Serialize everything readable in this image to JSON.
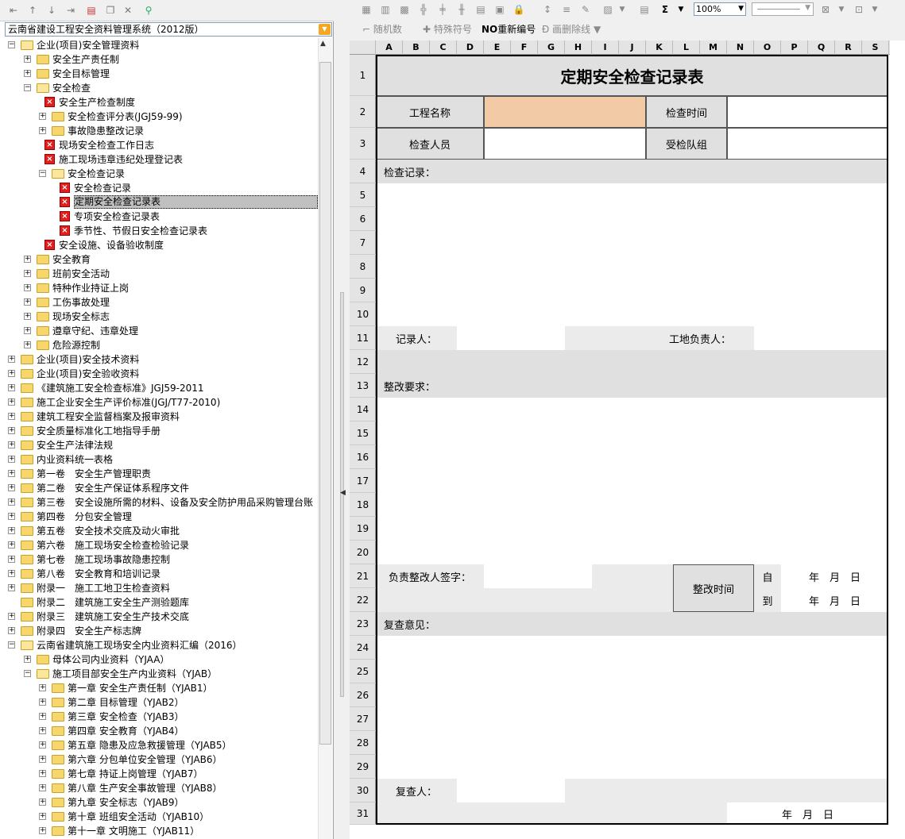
{
  "left_toolbar": {
    "icons": [
      "first-icon",
      "prev-icon",
      "next-icon",
      "last-icon",
      "add-record-icon",
      "copy-icon",
      "delete-icon",
      "filter-icon"
    ]
  },
  "selector": {
    "value": "云南省建设工程安全资料管理系统（2012版）"
  },
  "tree": [
    {
      "label": "企业(项目)安全管理资料",
      "level": 0,
      "type": "folder",
      "state": "open"
    },
    {
      "label": "安全生产责任制",
      "level": 1,
      "type": "folder",
      "state": "closed"
    },
    {
      "label": "安全目标管理",
      "level": 1,
      "type": "folder",
      "state": "closed"
    },
    {
      "label": "安全检查",
      "level": 1,
      "type": "folder",
      "state": "open"
    },
    {
      "label": "安全生产检查制度",
      "level": 2,
      "type": "doc"
    },
    {
      "label": "安全检查评分表(JGJ59-99)",
      "level": 2,
      "type": "folder",
      "state": "closed"
    },
    {
      "label": "事故隐患整改记录",
      "level": 2,
      "type": "folder",
      "state": "closed"
    },
    {
      "label": "现场安全检查工作日志",
      "level": 2,
      "type": "doc"
    },
    {
      "label": "施工现场违章违纪处理登记表",
      "level": 2,
      "type": "doc"
    },
    {
      "label": "安全检查记录",
      "level": 2,
      "type": "folder",
      "state": "open"
    },
    {
      "label": "安全检查记录",
      "level": 3,
      "type": "doc"
    },
    {
      "label": "定期安全检查记录表",
      "level": 3,
      "type": "doc",
      "selected": true
    },
    {
      "label": "专项安全检查记录表",
      "level": 3,
      "type": "doc"
    },
    {
      "label": "季节性、节假日安全检查记录表",
      "level": 3,
      "type": "doc"
    },
    {
      "label": "安全设施、设备验收制度",
      "level": 2,
      "type": "doc"
    },
    {
      "label": "安全教育",
      "level": 1,
      "type": "folder",
      "state": "closed"
    },
    {
      "label": "班前安全活动",
      "level": 1,
      "type": "folder",
      "state": "closed"
    },
    {
      "label": "特种作业持证上岗",
      "level": 1,
      "type": "folder",
      "state": "closed"
    },
    {
      "label": "工伤事故处理",
      "level": 1,
      "type": "folder",
      "state": "closed"
    },
    {
      "label": "现场安全标志",
      "level": 1,
      "type": "folder",
      "state": "closed"
    },
    {
      "label": "遵章守纪、违章处理",
      "level": 1,
      "type": "folder",
      "state": "closed"
    },
    {
      "label": "危险源控制",
      "level": 1,
      "type": "folder",
      "state": "closed"
    },
    {
      "label": "企业(项目)安全技术资料",
      "level": 0,
      "type": "folder",
      "state": "closed"
    },
    {
      "label": "企业(项目)安全验收资料",
      "level": 0,
      "type": "folder",
      "state": "closed"
    },
    {
      "label": "《建筑施工安全检查标准》JGJ59-2011",
      "level": 0,
      "type": "folder",
      "state": "closed"
    },
    {
      "label": "施工企业安全生产评价标准(JGJ/T77-2010)",
      "level": 0,
      "type": "folder",
      "state": "closed"
    },
    {
      "label": "建筑工程安全监督档案及报审资料",
      "level": 0,
      "type": "folder",
      "state": "closed"
    },
    {
      "label": "安全质量标准化工地指导手册",
      "level": 0,
      "type": "folder",
      "state": "closed"
    },
    {
      "label": "安全生产法律法规",
      "level": 0,
      "type": "folder",
      "state": "closed"
    },
    {
      "label": "内业资料统一表格",
      "level": 0,
      "type": "folder",
      "state": "closed"
    },
    {
      "label": "第一卷　安全生产管理职责",
      "level": 0,
      "type": "folder",
      "state": "closed"
    },
    {
      "label": "第二卷　安全生产保证体系程序文件",
      "level": 0,
      "type": "folder",
      "state": "closed"
    },
    {
      "label": "第三卷　安全设施所需的材料、设备及安全防护用品采购管理台账",
      "level": 0,
      "type": "folder",
      "state": "closed"
    },
    {
      "label": "第四卷　分包安全管理",
      "level": 0,
      "type": "folder",
      "state": "closed"
    },
    {
      "label": "第五卷　安全技术交底及动火审批",
      "level": 0,
      "type": "folder",
      "state": "closed"
    },
    {
      "label": "第六卷　施工现场安全检查检验记录",
      "level": 0,
      "type": "folder",
      "state": "closed"
    },
    {
      "label": "第七卷　施工现场事故隐患控制",
      "level": 0,
      "type": "folder",
      "state": "closed"
    },
    {
      "label": "第八卷　安全教育和培训记录",
      "level": 0,
      "type": "folder",
      "state": "closed"
    },
    {
      "label": "附录一　施工工地卫生检查资料",
      "level": 0,
      "type": "folder",
      "state": "closed"
    },
    {
      "label": "附录二　建筑施工安全生产测验题库",
      "level": 0,
      "type": "folder",
      "state": "none"
    },
    {
      "label": "附录三　建筑施工安全生产技术交底",
      "level": 0,
      "type": "folder",
      "state": "closed"
    },
    {
      "label": "附录四　安全生产标志牌",
      "level": 0,
      "type": "folder",
      "state": "closed"
    },
    {
      "label": "云南省建筑施工现场安全内业资料汇编（2016）",
      "level": 0,
      "type": "folder",
      "state": "open"
    },
    {
      "label": "母体公司内业资料（YJAA）",
      "level": 1,
      "type": "folder",
      "state": "closed"
    },
    {
      "label": "施工项目部安全生产内业资料（YJAB）",
      "level": 1,
      "type": "folder",
      "state": "open"
    },
    {
      "label": "第一章 安全生产责任制（YJAB1）",
      "level": 2,
      "type": "folder",
      "state": "closed"
    },
    {
      "label": "第二章 目标管理（YJAB2）",
      "level": 2,
      "type": "folder",
      "state": "closed"
    },
    {
      "label": "第三章 安全检查（YJAB3）",
      "level": 2,
      "type": "folder",
      "state": "closed"
    },
    {
      "label": "第四章 安全教育（YJAB4）",
      "level": 2,
      "type": "folder",
      "state": "closed"
    },
    {
      "label": "第五章 隐患及应急救援管理（YJAB5）",
      "level": 2,
      "type": "folder",
      "state": "closed"
    },
    {
      "label": "第六章 分包单位安全管理（YJAB6）",
      "level": 2,
      "type": "folder",
      "state": "closed"
    },
    {
      "label": "第七章 持证上岗管理（YJAB7）",
      "level": 2,
      "type": "folder",
      "state": "closed"
    },
    {
      "label": "第八章 生产安全事故管理（YJAB8）",
      "level": 2,
      "type": "folder",
      "state": "closed"
    },
    {
      "label": "第九章 安全标志（YJAB9）",
      "level": 2,
      "type": "folder",
      "state": "closed"
    },
    {
      "label": "第十章 班组安全活动（YJAB10）",
      "level": 2,
      "type": "folder",
      "state": "closed"
    },
    {
      "label": "第十一章 文明施工（YJAB11）",
      "level": 2,
      "type": "folder",
      "state": "closed"
    }
  ],
  "right_toolbar": {
    "zoom": "100%",
    "sigma": "Σ",
    "row2": [
      {
        "label": "随机数",
        "active": false
      },
      {
        "label": "特殊符号",
        "active": false
      },
      {
        "label": "重新编号",
        "prefix": "NO",
        "active": true
      },
      {
        "label": "画删除线",
        "active": false
      }
    ]
  },
  "sheet": {
    "columns": [
      "A",
      "B",
      "C",
      "D",
      "E",
      "F",
      "G",
      "H",
      "I",
      "J",
      "K",
      "L",
      "M",
      "N",
      "O",
      "P",
      "Q",
      "R",
      "S"
    ],
    "rows": [
      "1",
      "2",
      "3",
      "4",
      "5",
      "6",
      "7",
      "8",
      "9",
      "10",
      "11",
      "12",
      "13",
      "14",
      "15",
      "16",
      "17",
      "18",
      "19",
      "20",
      "21",
      "22",
      "23",
      "24",
      "25",
      "26",
      "27",
      "28",
      "29",
      "30",
      "31"
    ],
    "title": "定期安全检查记录表",
    "project_name_label": "工程名称",
    "check_time_label": "检查时间",
    "inspector_label": "检查人员",
    "team_label": "受检队组",
    "check_record_label": "检查记录：",
    "recorder_label": "记录人：",
    "site_leader_label": "工地负责人：",
    "rectify_req_label": "整改要求：",
    "rectify_signer_label": "负责整改人签字：",
    "rectify_time_label": "整改时间",
    "from_label": "自",
    "to_label": "到",
    "date_ymd_1": "年　月　日",
    "date_ymd_2": "年　月　日",
    "review_label": "复查意见：",
    "reviewer_label": "复查人：",
    "date_ymd_3": "年　月　日"
  }
}
